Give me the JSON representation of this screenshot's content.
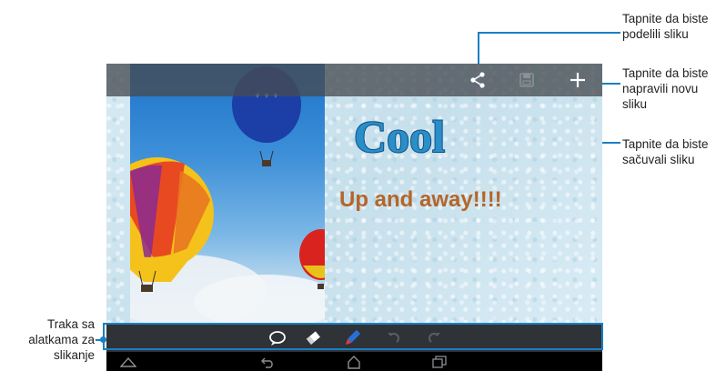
{
  "callouts": {
    "share": [
      "Tapnite da biste",
      "podelili sliku"
    ],
    "new": [
      "Tapnite da biste",
      "napravili novu",
      "sliku"
    ],
    "save": [
      "Tapnite da biste",
      "sačuvali sliku"
    ],
    "toolbar": [
      "Traka sa",
      "alatkama za",
      "slikanje"
    ]
  },
  "canvas": {
    "sticker_text": "Cool",
    "headline": "Up and away!!!!"
  },
  "topbar": {
    "icons": [
      "share-icon",
      "save-icon",
      "plus-icon"
    ]
  },
  "toolbar": {
    "icons": [
      "speech-bubble-icon",
      "eraser-icon",
      "pen-icon",
      "undo-icon",
      "redo-icon"
    ]
  },
  "navbar": {
    "icons": [
      "home-icon",
      "back-icon",
      "house-icon",
      "recent-apps-icon"
    ]
  },
  "colors": {
    "callout_line": "#1a7fc4",
    "headline": "#b5652a",
    "cool_fill": "#2a8ec9",
    "pen_blue": "#2a6fd6",
    "toolbar_bg": "#2f3236"
  }
}
